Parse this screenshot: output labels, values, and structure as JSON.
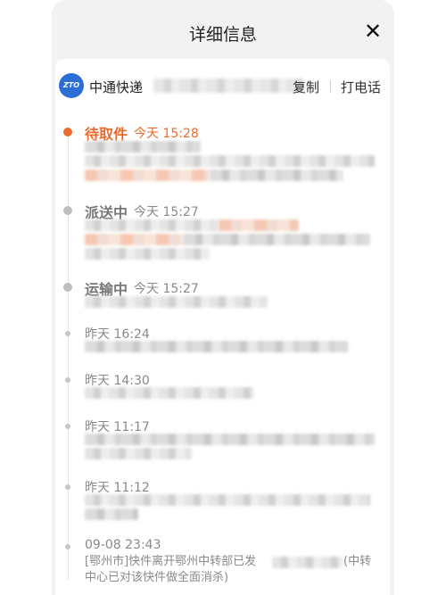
{
  "header": {
    "title": "详细信息",
    "close_icon": "close-icon"
  },
  "courier": {
    "name": "中通快递",
    "logo_text": "ZTO",
    "copy_label": "复制",
    "call_label": "打电话",
    "brand_color": "#2b6fd6"
  },
  "accent_color": "#ee6a2a",
  "events": [
    {
      "status": "待取件",
      "time": "今天 15:28",
      "state": "active"
    },
    {
      "status": "派送中",
      "time": "今天 15:27",
      "state": "past"
    },
    {
      "status": "运输中",
      "time": "今天 15:27",
      "state": "past"
    },
    {
      "status": "",
      "time": "昨天 16:24",
      "state": "minor"
    },
    {
      "status": "",
      "time": "昨天 14:30",
      "state": "minor"
    },
    {
      "status": "",
      "time": "昨天 11:17",
      "state": "minor"
    },
    {
      "status": "",
      "time": "昨天 11:12",
      "state": "minor"
    },
    {
      "status": "",
      "time": "09-08 23:43",
      "state": "minor",
      "text_line1": "[鄂州市]快件离开鄂州中转部已发",
      "text_line1_tail": "(中转",
      "text_line2": "中心已对该快件做全面消杀)"
    }
  ]
}
